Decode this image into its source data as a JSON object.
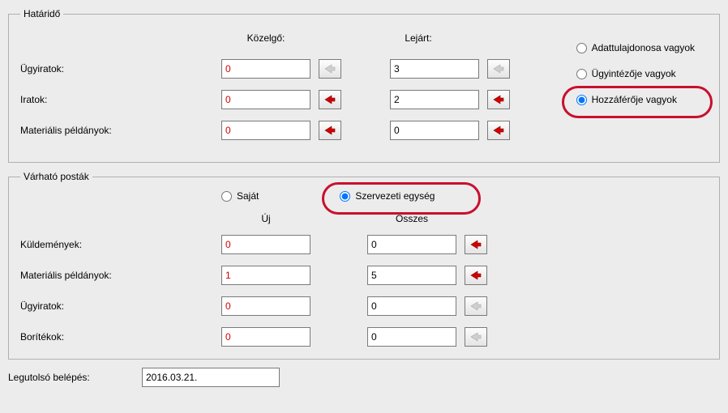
{
  "deadline": {
    "legend": "Határidő",
    "col_upcoming": "Közelgő:",
    "col_expired": "Lejárt:",
    "rows": {
      "ugyiratok": {
        "label": "Ügyiratok:",
        "upcoming": "0",
        "expired": "3",
        "arrow_upcoming_active": false,
        "arrow_expired_active": false
      },
      "iratok": {
        "label": "Iratok:",
        "upcoming": "0",
        "expired": "2",
        "arrow_upcoming_active": true,
        "arrow_expired_active": true
      },
      "material": {
        "label": "Materiális példányok:",
        "upcoming": "0",
        "expired": "0",
        "arrow_upcoming_active": true,
        "arrow_expired_active": true
      }
    },
    "radios": {
      "owner": "Adattulajdonosa vagyok",
      "clerk": "Ügyintézője vagyok",
      "accessor": "Hozzáférője vagyok",
      "selected": "accessor"
    }
  },
  "expected_mail": {
    "legend": "Várható posták",
    "radio_own": "Saját",
    "radio_org": "Szervezeti egység",
    "radio_selected": "org",
    "col_new": "Új",
    "col_all": "Összes",
    "rows": {
      "kuldemenyek": {
        "label": "Küldemények:",
        "new": "0",
        "all": "0",
        "arrow_active": true
      },
      "material": {
        "label": "Materiális példányok:",
        "new": "1",
        "all": "5",
        "arrow_active": true
      },
      "ugyiratok": {
        "label": "Ügyiratok:",
        "new": "0",
        "all": "0",
        "arrow_active": false
      },
      "boritekok": {
        "label": "Borítékok:",
        "new": "0",
        "all": "0",
        "arrow_active": false
      }
    }
  },
  "last_login": {
    "label": "Legutolsó belépés:",
    "value": "2016.03.21."
  }
}
